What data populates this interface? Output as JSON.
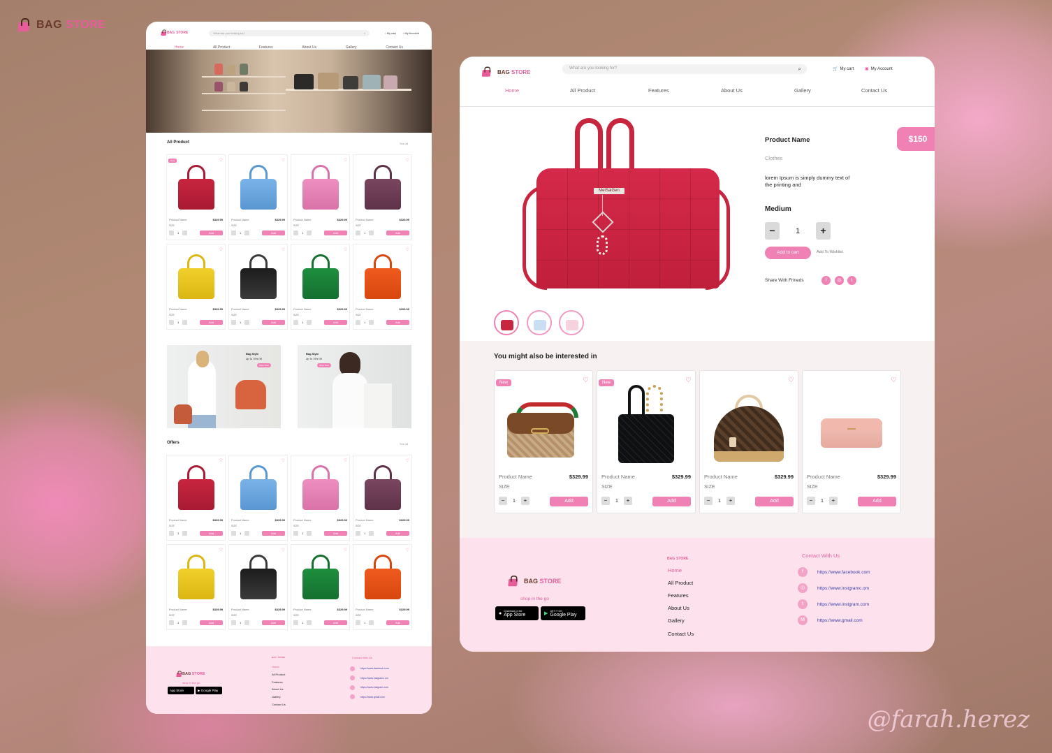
{
  "brand": {
    "bag": "BAG",
    "store": "STORE"
  },
  "signature": "@farah.herez",
  "left": {
    "search_placeholder": "What are you looking for?",
    "my_cart": "My cart",
    "my_account": "My Account",
    "nav": [
      "Home",
      "All Product",
      "Features",
      "About Us",
      "Gallery",
      "Contact Us"
    ],
    "all_product": "All Product",
    "see_all": "See all",
    "offers": "Offers",
    "product_name": "Product Name",
    "price": "$329.99",
    "size": "SIZE",
    "add": "Add",
    "new": "New",
    "promo": {
      "title": "Bag Style",
      "subtitle": "Up To 70% Off",
      "button": "Shop Now"
    },
    "footer": {
      "shop": "shop in the go",
      "links": [
        "Home",
        "All Product",
        "Features",
        "About Us",
        "Gallery",
        "Contact Us"
      ],
      "contact_title": "Contact With Us",
      "contacts": [
        "https://www.facebook.com",
        "https://www.instgramc.om",
        "https://www.instgram.com",
        "https://www.gmail.com"
      ]
    }
  },
  "right": {
    "search_placeholder": "What are you looking for?",
    "my_cart": "My cart",
    "my_account": "My Account",
    "nav": [
      "Home",
      "All Product",
      "Features",
      "About Us",
      "Gallery",
      "Contact Us"
    ],
    "product": {
      "name": "Product Name",
      "price": "$150",
      "category": "Clothes",
      "description": "lorem Ipsum is simply dummy text of the printing and",
      "size": "Medium",
      "quantity": "1",
      "minus": "−",
      "plus": "+",
      "add_to_cart": "Add to cart",
      "wishlist": "Add To Wishlist",
      "share": "Share With Frineds",
      "brand_plate": "MeiSaiGen"
    },
    "interest_title": "You might also be interested in",
    "cards": [
      {
        "new": "New",
        "name": "Product Name",
        "price": "$329.99",
        "size": "SIZE",
        "qty": "1",
        "add": "Add"
      },
      {
        "new": "New",
        "name": "Product Name",
        "price": "$329.99",
        "size": "SIZE",
        "qty": "1",
        "add": "Add"
      },
      {
        "new": "",
        "name": "Product Name",
        "price": "$329.99",
        "size": "SIZE",
        "qty": "1",
        "add": "Add"
      },
      {
        "new": "",
        "name": "Product Name",
        "price": "$329.99",
        "size": "SIZE",
        "qty": "1",
        "add": "Add"
      }
    ],
    "footer": {
      "shop": "shop in the go",
      "app_store_small": "Download on the",
      "app_store": "App Store",
      "google_small": "GET IT ON",
      "google": "Google Play",
      "links": [
        "Home",
        "All Product",
        "Features",
        "About Us",
        "Gallery",
        "Contact Us"
      ],
      "contact_title": "Contact With Us",
      "contacts": [
        "https://www.facebook.com",
        "https://www.instgramc.om",
        "https://www.instgram.com",
        "https://www.gmail.com"
      ]
    }
  },
  "colors": {
    "accent": "#f081b4",
    "brand_pink": "#e75d9a",
    "footer_bg": "#fde2ee"
  }
}
